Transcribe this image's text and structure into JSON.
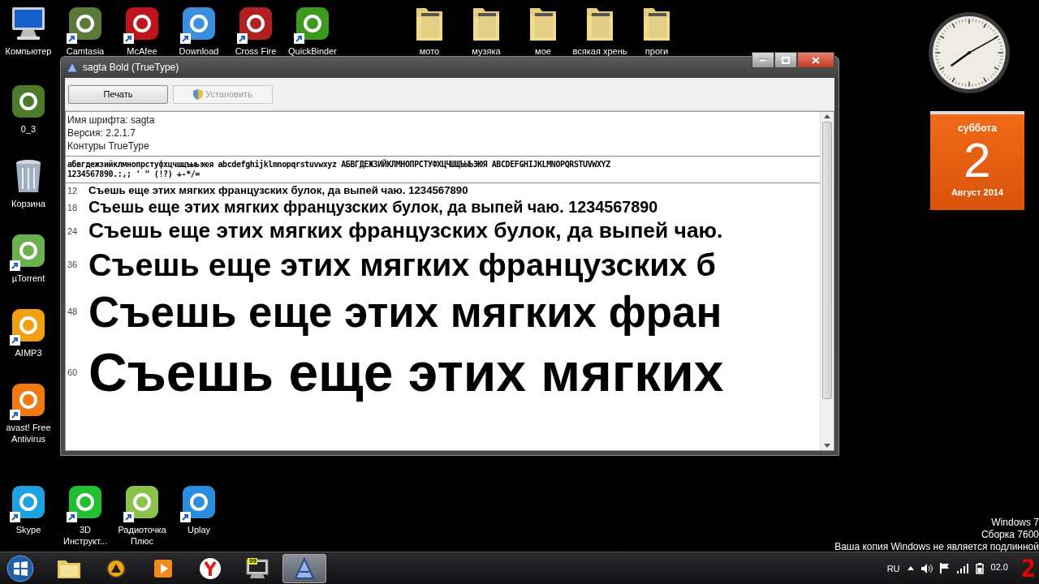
{
  "desktop": {
    "top_apps": [
      {
        "label": "Компьютер",
        "kind": "computer",
        "shortcut": false
      },
      {
        "label": "Camtasia",
        "kind": "app",
        "color": "#5a7a3a",
        "shortcut": true
      },
      {
        "label": "McAfee",
        "kind": "app",
        "color": "#c0141c",
        "shortcut": true
      },
      {
        "label": "Download",
        "kind": "app",
        "color": "#3a8fe0",
        "shortcut": true
      },
      {
        "label": "Cross Fire",
        "kind": "app",
        "color": "#b02020",
        "shortcut": true
      },
      {
        "label": "QuickBinder",
        "kind": "app",
        "color": "#3c9a1e",
        "shortcut": true
      }
    ],
    "top_folders": [
      {
        "label": "мото",
        "kind": "folder",
        "shortcut": false
      },
      {
        "label": "музяка",
        "kind": "folder",
        "shortcut": false
      },
      {
        "label": "мое",
        "kind": "folder",
        "shortcut": false
      },
      {
        "label": "всякая хрень",
        "kind": "folder",
        "shortcut": false
      },
      {
        "label": "проги",
        "kind": "folder",
        "shortcut": false
      }
    ],
    "left_column": [
      {
        "label": "0_3",
        "kind": "app",
        "color": "#4a7a2a",
        "shortcut": false
      },
      {
        "label": "Корзина",
        "kind": "bin",
        "shortcut": false
      },
      {
        "label": "µTorrent",
        "kind": "app",
        "color": "#6ab04c",
        "shortcut": true
      },
      {
        "label": "AIMP3",
        "kind": "app",
        "color": "#f0a010",
        "shortcut": true
      },
      {
        "label": "avast! Free Antivirus",
        "kind": "app",
        "color": "#f07a10",
        "shortcut": true
      }
    ],
    "bottom_row": [
      {
        "label": "Skype",
        "kind": "app",
        "color": "#1da1e0",
        "shortcut": true
      },
      {
        "label": "3D Инструкт...",
        "kind": "app",
        "color": "#20c030",
        "shortcut": true
      },
      {
        "label": "Радиоточка Плюс",
        "kind": "app",
        "color": "#8bc34a",
        "shortcut": true
      },
      {
        "label": "Uplay",
        "kind": "app",
        "color": "#2a8ee0",
        "shortcut": true
      }
    ]
  },
  "font_window": {
    "title": "sagta Bold (TrueType)",
    "buttons": [
      {
        "label": "Печать",
        "disabled": false
      },
      {
        "label": "Установить",
        "disabled": true
      }
    ],
    "info": [
      "Имя шрифта: sagta",
      "Версия: 2.2.1.7",
      "Контуры TrueType"
    ],
    "charset": [
      "абвгдежзийклмнопрстуфхцчшщъыьэюя abcdefghijklmnopqrstuvwxyz АБВГДЕЖЗИЙКЛМНОПРСТУФХЦЧШЩЪЫЬЭЮЯ ABCDEFGHIJKLMNOPQRSTUVWXYZ",
      "1234567890.:,; ' \" (!?) +-*/="
    ],
    "samples": [
      {
        "size": "12",
        "text": "Съешь еще этих мягких французских булок, да выпей чаю. 1234567890"
      },
      {
        "size": "18",
        "text": "Съешь еще этих мягких французских булок, да выпей чаю. 1234567890"
      },
      {
        "size": "24",
        "text": "Съешь еще этих мягких французских булок, да выпей чаю."
      },
      {
        "size": "36",
        "text": "Съешь еще этих мягких французских б"
      },
      {
        "size": "48",
        "text": "Съешь еще этих мягких фран"
      },
      {
        "size": "60",
        "text": "Съешь еще этих мягких"
      }
    ]
  },
  "calendar": {
    "weekday": "суббота",
    "day": "2",
    "month_year": "Август 2014"
  },
  "os_notice": [
    "Windows 7",
    "Сборка 7600",
    "Ваша копия Windows не является подлинной"
  ],
  "taskbar": {
    "items": [
      {
        "kind": "explorer",
        "active": false
      },
      {
        "kind": "aimp",
        "active": false
      },
      {
        "kind": "player",
        "active": false
      },
      {
        "kind": "yandex",
        "active": false
      },
      {
        "kind": "monitor",
        "badge": "99",
        "active": false
      },
      {
        "kind": "fontviewer",
        "active": true
      }
    ],
    "language": "RU",
    "date": "02.0",
    "corner_digits": "2"
  }
}
